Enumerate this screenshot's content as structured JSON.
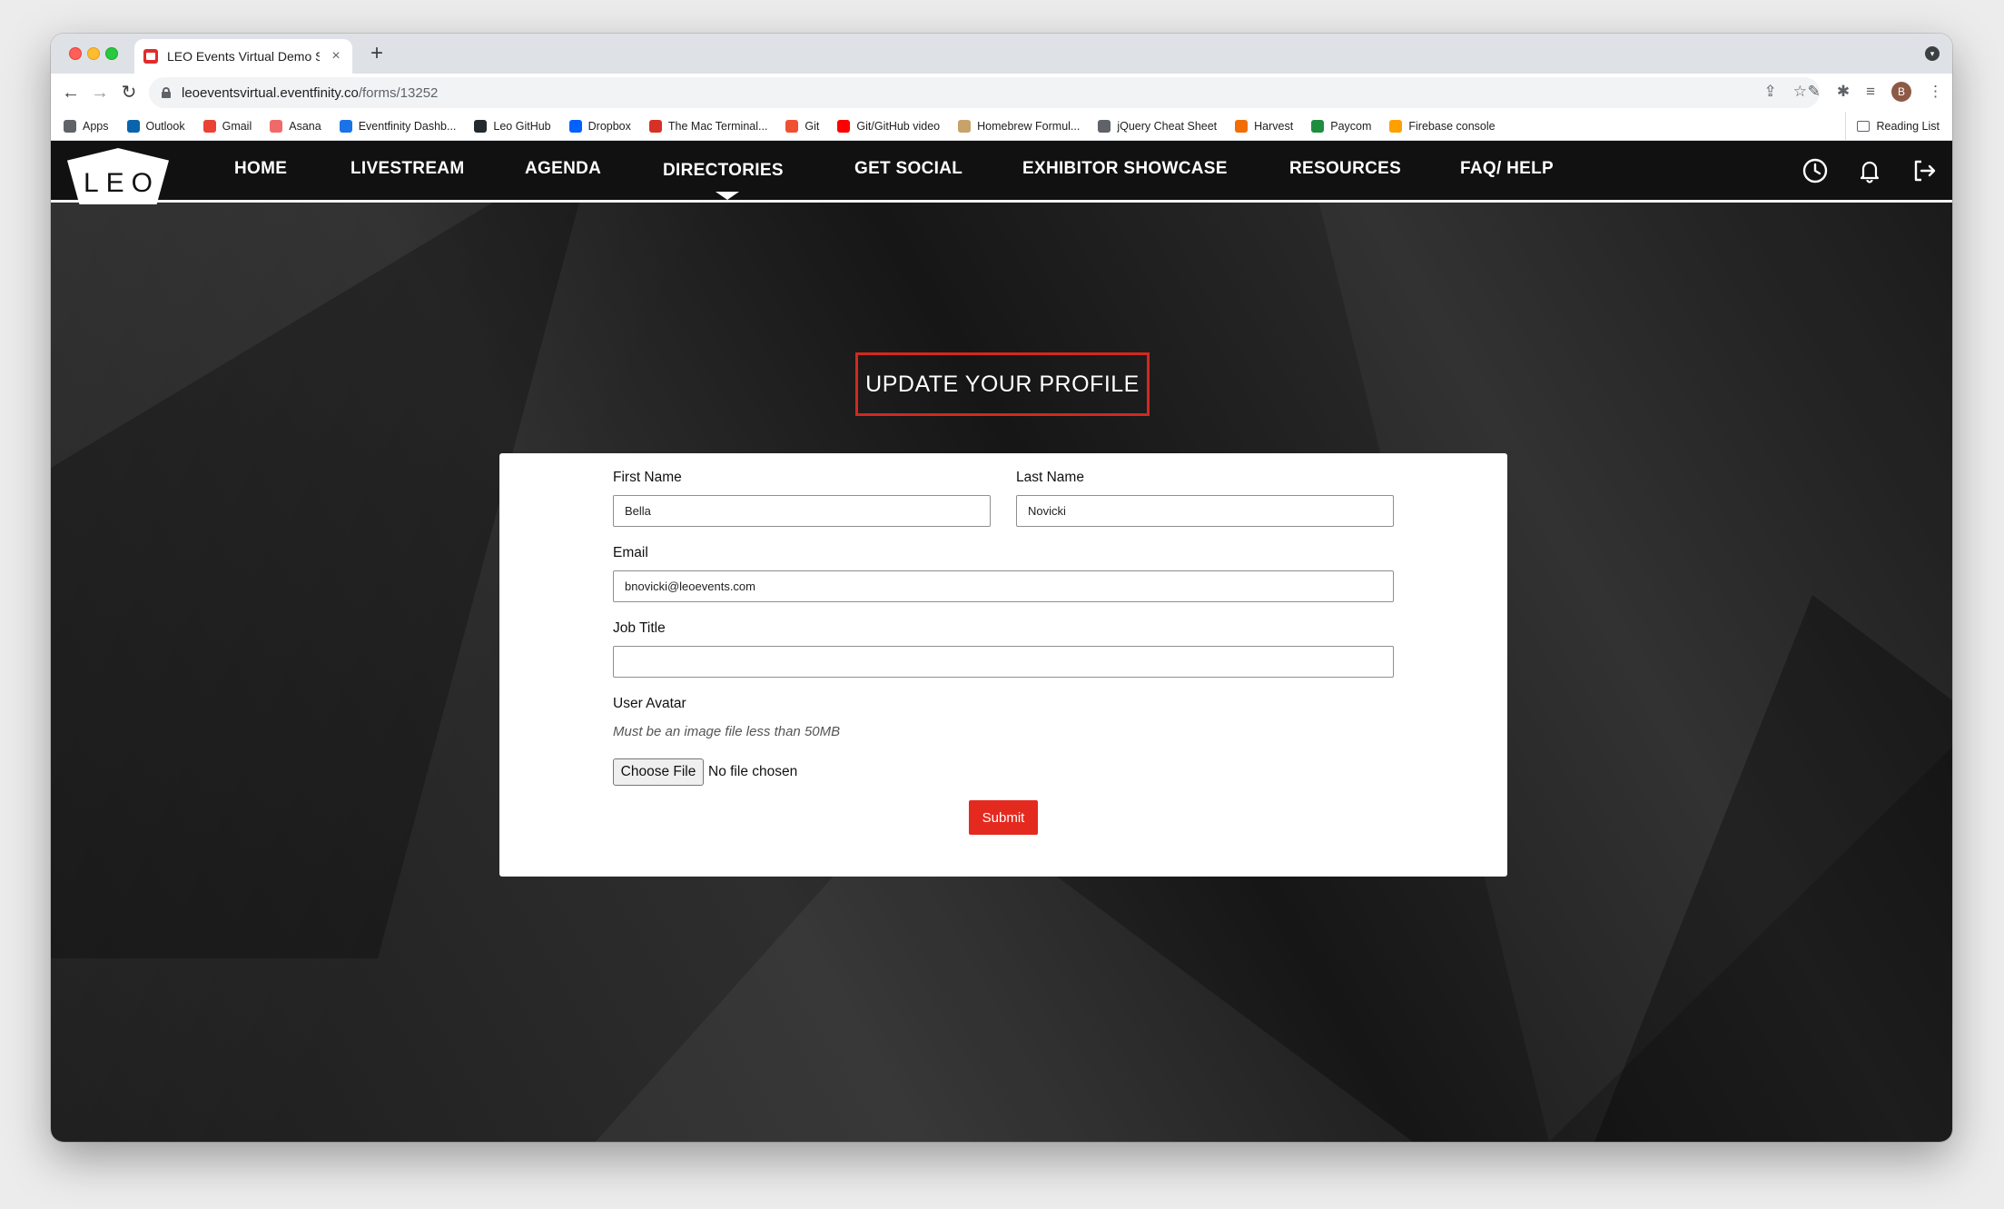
{
  "browser": {
    "tab_title": "LEO Events Virtual Demo Site",
    "tab_close": "×",
    "new_tab": "+",
    "url_host": "leoeventsvirtual.eventfinity.co",
    "url_path": "/forms/13252",
    "avatar_initial": "B",
    "bookmarks": [
      {
        "label": "Apps",
        "color": "#5f6368"
      },
      {
        "label": "Outlook",
        "color": "#0a64ad"
      },
      {
        "label": "Gmail",
        "color": "#ea4335"
      },
      {
        "label": "Asana",
        "color": "#f06a6a"
      },
      {
        "label": "Eventfinity Dashb...",
        "color": "#1a73e8"
      },
      {
        "label": "Leo GitHub",
        "color": "#24292e"
      },
      {
        "label": "Dropbox",
        "color": "#0061fe"
      },
      {
        "label": "The Mac Terminal...",
        "color": "#d93025"
      },
      {
        "label": "Git",
        "color": "#f05032"
      },
      {
        "label": "Git/GitHub video",
        "color": "#ff0000"
      },
      {
        "label": "Homebrew Formul...",
        "color": "#c8a26b"
      },
      {
        "label": "jQuery Cheat Sheet",
        "color": "#5f6368"
      },
      {
        "label": "Harvest",
        "color": "#f36c00"
      },
      {
        "label": "Paycom",
        "color": "#1e8e3e"
      },
      {
        "label": "Firebase console",
        "color": "#ffa000"
      }
    ],
    "reading_list": "Reading List"
  },
  "site": {
    "logo_text": "LEO",
    "nav": [
      "Home",
      "Livestream",
      "Agenda",
      "Directories",
      "Get Social",
      "Exhibitor Showcase",
      "Resources",
      "FAQ/ Help"
    ],
    "active_nav": "Directories"
  },
  "form": {
    "heading": "UPDATE YOUR PROFILE",
    "first_name_label": "First Name",
    "first_name_value": "Bella",
    "last_name_label": "Last Name",
    "last_name_value": "Novicki",
    "email_label": "Email",
    "email_value": "bnovicki@leoevents.com",
    "job_title_label": "Job Title",
    "job_title_value": "",
    "avatar_label": "User Avatar",
    "avatar_hint": "Must be an image file less than 50MB",
    "choose_file_label": "Choose File",
    "file_status": "No file chosen",
    "submit_label": "Submit"
  },
  "colors": {
    "accent": "#e42a1f",
    "nav_bg": "#111111"
  }
}
